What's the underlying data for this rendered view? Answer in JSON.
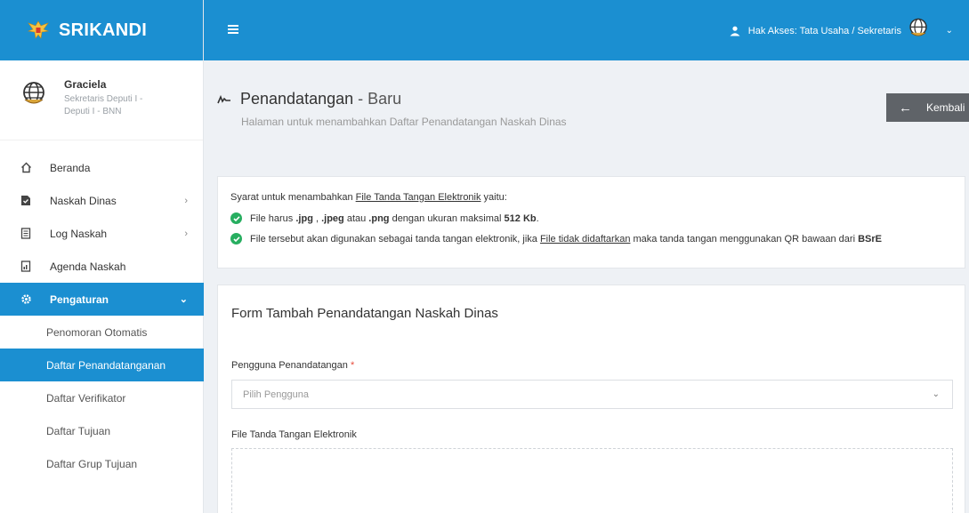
{
  "app": {
    "name": "SRIKANDI"
  },
  "profile": {
    "name": "Graciela",
    "role": "Sekretaris Deputi I - Deputi I - BNN"
  },
  "menu": [
    {
      "label": "Beranda",
      "icon": "home-icon",
      "has_children": false
    },
    {
      "label": "Naskah Dinas",
      "icon": "document-icon",
      "has_children": true
    },
    {
      "label": "Log Naskah",
      "icon": "log-icon",
      "has_children": true
    },
    {
      "label": "Agenda Naskah",
      "icon": "agenda-icon",
      "has_children": false
    },
    {
      "label": "Pengaturan",
      "icon": "gear-icon",
      "has_children": true,
      "active": true
    }
  ],
  "submenu": [
    {
      "label": "Penomoran Otomatis"
    },
    {
      "label": "Daftar Penandatanganan",
      "active": true
    },
    {
      "label": "Daftar Verifikator"
    },
    {
      "label": "Daftar Tujuan"
    },
    {
      "label": "Daftar Grup Tujuan"
    }
  ],
  "topbar": {
    "access_label": "Hak Akses: Tata Usaha / Sekretaris"
  },
  "page": {
    "title": "Penandatangan",
    "title_suffix": " - Baru",
    "subtitle": "Halaman untuk menambahkan Daftar Penandatangan Naskah Dinas",
    "back_label": "Kembali"
  },
  "requirements": {
    "intro_prefix": "Syarat untuk menambahkan ",
    "intro_link": "File Tanda Tangan Elektronik",
    "intro_suffix": " yaitu:",
    "item1": {
      "t1": "File harus ",
      "b1": ".jpg",
      "t2": " , ",
      "b2": ".jpeg",
      "t3": " atau ",
      "b3": ".png",
      "t4": " dengan ukuran maksimal ",
      "b4": "512 Kb",
      "t5": "."
    },
    "item2": {
      "t1": "File tersebut akan digunakan sebagai tanda tangan elektronik, jika ",
      "link": "File tidak didaftarkan",
      "t2": " maka tanda tangan menggunakan QR bawaan dari ",
      "b1": "BSrE"
    }
  },
  "form": {
    "title": "Form Tambah Penandatangan Naskah Dinas",
    "user_label": "Pengguna Penandatangan",
    "required_mark": "*",
    "user_placeholder": "Pilih Pengguna",
    "file_label": "File Tanda Tangan Elektronik"
  },
  "colors": {
    "primary": "#1b8fd1",
    "success": "#27ae60",
    "back_button": "#5f6368",
    "required": "#e74c3c"
  }
}
